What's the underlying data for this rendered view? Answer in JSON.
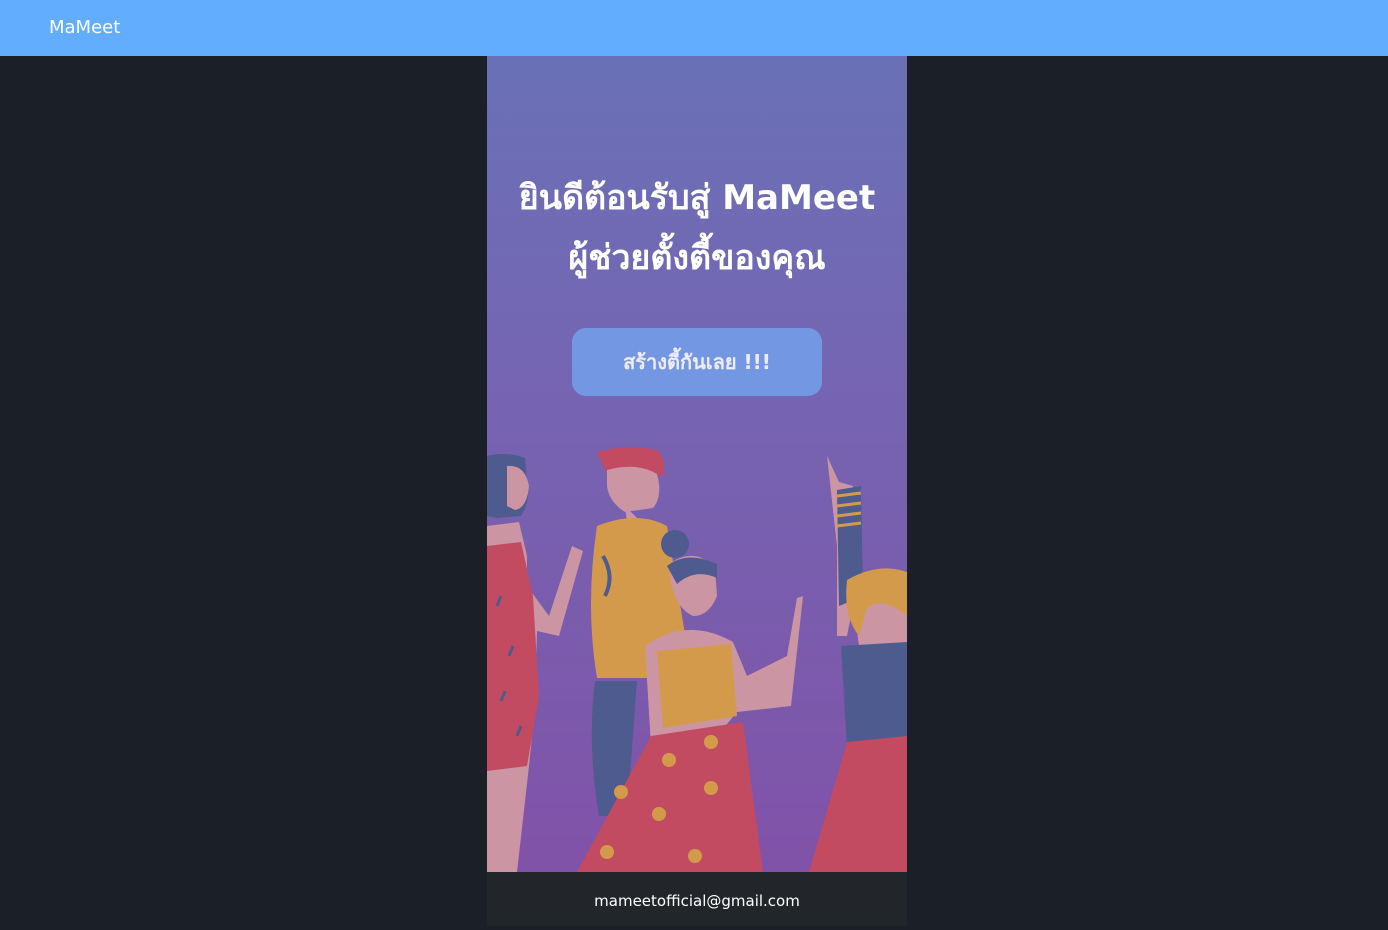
{
  "navbar": {
    "brand": "MaMeet",
    "background": "#62adfe"
  },
  "hero": {
    "title_line1": "ยินดีต้อนรับสู่ MaMeet",
    "title_line2": "ผู้ช่วยตั้งตี้ของคุณ",
    "cta_label": "สร้างตี้กันเลย !!!",
    "cta_color": "#7397e3",
    "illustration": "party-people-illustration"
  },
  "footer": {
    "email": "mameetofficial@gmail.com"
  },
  "colors": {
    "page_bg": "#1b1f27",
    "gradient_top": "#6a70b6",
    "gradient_bottom": "#8052a8",
    "footer_bg": "#222529"
  }
}
